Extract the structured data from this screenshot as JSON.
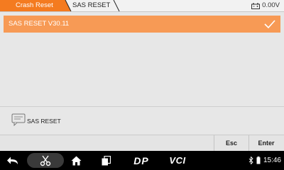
{
  "breadcrumb": {
    "items": [
      {
        "label": "Crash Reset"
      },
      {
        "label": "SAS RESET"
      }
    ]
  },
  "battery": {
    "voltage": "0.00V",
    "icon": "car-battery-icon"
  },
  "menu": {
    "items": [
      {
        "label": "SAS RESET  V30.11",
        "selected": true
      }
    ]
  },
  "info": {
    "message": "SAS RESET",
    "icon": "message-icon"
  },
  "actions": {
    "esc_label": "Esc",
    "enter_label": "Enter"
  },
  "navbar": {
    "icons": [
      "back-icon",
      "scissors-icon",
      "home-icon",
      "recent-apps-icon"
    ],
    "dp_label": "DP",
    "vci_label": "VCI",
    "time": "15:46"
  },
  "colors": {
    "accent": "#f47b20",
    "selected_row": "#f79a55",
    "background": "#e7e7e7"
  }
}
